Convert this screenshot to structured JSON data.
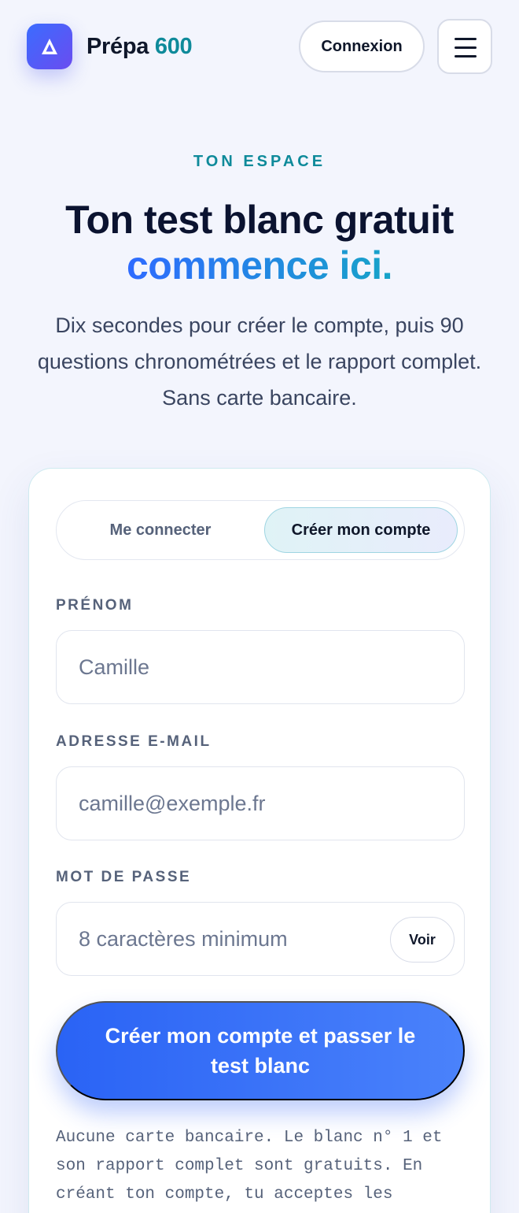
{
  "header": {
    "brand_name": "Prépa",
    "brand_accent": "600",
    "login_label": "Connexion",
    "menu_icon": "hamburger-icon",
    "logo_icon": "delta-logo-icon"
  },
  "hero": {
    "eyebrow": "TON ESPACE",
    "title": "Ton test blanc gratuit",
    "title_accent": "commence ici.",
    "lead": "Dix secondes pour créer le compte, puis 90 questions chronométrées et le rapport complet. Sans carte bancaire."
  },
  "form": {
    "tabs": [
      {
        "label": "Me connecter",
        "active": false
      },
      {
        "label": "Créer mon compte",
        "active": true
      }
    ],
    "first_name": {
      "label": "PRÉNOM",
      "placeholder": "Camille",
      "value": ""
    },
    "email": {
      "label": "ADRESSE E-MAIL",
      "placeholder": "camille@exemple.fr",
      "value": ""
    },
    "password": {
      "label": "MOT DE PASSE",
      "placeholder": "8 caractères minimum",
      "value": "",
      "toggle_label": "Voir"
    },
    "submit_label": "Créer mon compte et passer le test blanc",
    "fineprint": "Aucune carte bancaire. Le blanc n° 1 et son rapport complet sont gratuits. En créant ton compte, tu acceptes les"
  },
  "colors": {
    "background": "#f3f5fd",
    "accent_teal": "#0e8a9a",
    "accent_blue": "#2f6bff",
    "text_dark": "#0b1330"
  }
}
